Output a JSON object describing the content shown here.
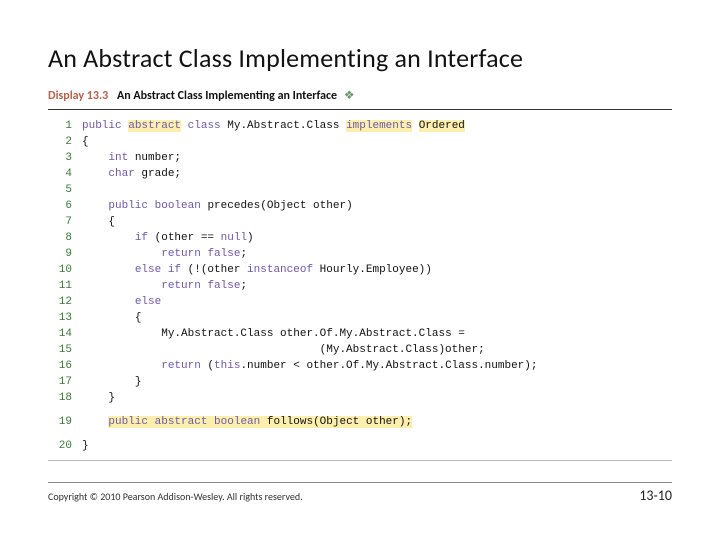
{
  "title": "An Abstract Class Implementing an Interface",
  "display": {
    "label": "Display 13.3",
    "title": "An Abstract Class Implementing an Interface",
    "diamond": "❖"
  },
  "code": {
    "lines": [
      {
        "n": "1",
        "pre": "",
        "tokens": [
          {
            "t": "public",
            "c": "kw"
          },
          {
            "t": " "
          },
          {
            "t": "abstract",
            "c": "kw hl"
          },
          {
            "t": " "
          },
          {
            "t": "class",
            "c": "kw"
          },
          {
            "t": " My.Abstract.Class "
          },
          {
            "t": "implements",
            "c": "kw hl"
          },
          {
            "t": " "
          },
          {
            "t": "Ordered",
            "c": "hl"
          }
        ]
      },
      {
        "n": "2",
        "pre": "",
        "tokens": [
          {
            "t": "{"
          }
        ]
      },
      {
        "n": "3",
        "pre": "    ",
        "tokens": [
          {
            "t": "int",
            "c": "kw"
          },
          {
            "t": " number;"
          }
        ]
      },
      {
        "n": "4",
        "pre": "    ",
        "tokens": [
          {
            "t": "char",
            "c": "kw"
          },
          {
            "t": " grade;"
          }
        ]
      },
      {
        "n": "5",
        "pre": "",
        "tokens": [
          {
            "t": " "
          }
        ]
      },
      {
        "n": "6",
        "pre": "    ",
        "tokens": [
          {
            "t": "public",
            "c": "kw"
          },
          {
            "t": " "
          },
          {
            "t": "boolean",
            "c": "kw"
          },
          {
            "t": " precedes(Object other)"
          }
        ]
      },
      {
        "n": "7",
        "pre": "    ",
        "tokens": [
          {
            "t": "{"
          }
        ]
      },
      {
        "n": "8",
        "pre": "        ",
        "tokens": [
          {
            "t": "if",
            "c": "kw"
          },
          {
            "t": " (other == "
          },
          {
            "t": "null",
            "c": "kw"
          },
          {
            "t": ")"
          }
        ]
      },
      {
        "n": "9",
        "pre": "            ",
        "tokens": [
          {
            "t": "return",
            "c": "kw"
          },
          {
            "t": " "
          },
          {
            "t": "false",
            "c": "kw"
          },
          {
            "t": ";"
          }
        ]
      },
      {
        "n": "10",
        "pre": "        ",
        "tokens": [
          {
            "t": "else if",
            "c": "kw"
          },
          {
            "t": " (!(other "
          },
          {
            "t": "instanceof",
            "c": "kw"
          },
          {
            "t": " Hourly.Employee))"
          }
        ]
      },
      {
        "n": "11",
        "pre": "            ",
        "tokens": [
          {
            "t": "return",
            "c": "kw"
          },
          {
            "t": " "
          },
          {
            "t": "false",
            "c": "kw"
          },
          {
            "t": ";"
          }
        ]
      },
      {
        "n": "12",
        "pre": "        ",
        "tokens": [
          {
            "t": "else",
            "c": "kw"
          }
        ]
      },
      {
        "n": "13",
        "pre": "        ",
        "tokens": [
          {
            "t": "{"
          }
        ]
      },
      {
        "n": "14",
        "pre": "            ",
        "tokens": [
          {
            "t": "My.Abstract.Class other.Of.My.Abstract.Class ="
          }
        ]
      },
      {
        "n": "15",
        "pre": "                                    ",
        "tokens": [
          {
            "t": "(My.Abstract.Class)other;"
          }
        ]
      },
      {
        "n": "16",
        "pre": "            ",
        "tokens": [
          {
            "t": "return",
            "c": "kw"
          },
          {
            "t": " ("
          },
          {
            "t": "this",
            "c": "kw"
          },
          {
            "t": ".number < other.Of.My.Abstract.Class.number);"
          }
        ]
      },
      {
        "n": "17",
        "pre": "        ",
        "tokens": [
          {
            "t": "}"
          }
        ]
      },
      {
        "n": "18",
        "pre": "    ",
        "tokens": [
          {
            "t": "}"
          }
        ]
      },
      {
        "n": "gap1",
        "gap": true
      },
      {
        "n": "19",
        "pre": "    ",
        "tokens": [
          {
            "t": "public",
            "c": "kw hl"
          },
          {
            "t": " ",
            "c": "hl"
          },
          {
            "t": "abstract",
            "c": "kw hl"
          },
          {
            "t": " ",
            "c": "hl"
          },
          {
            "t": "boolean",
            "c": "kw hl"
          },
          {
            "t": " follows(Object other);",
            "c": "hl"
          }
        ]
      },
      {
        "n": "gap2",
        "gap": true
      },
      {
        "n": "20",
        "pre": "",
        "tokens": [
          {
            "t": "}"
          }
        ]
      }
    ]
  },
  "footer": {
    "copyright": "Copyright © 2010 Pearson Addison-Wesley. All rights reserved.",
    "page": "13-10"
  }
}
